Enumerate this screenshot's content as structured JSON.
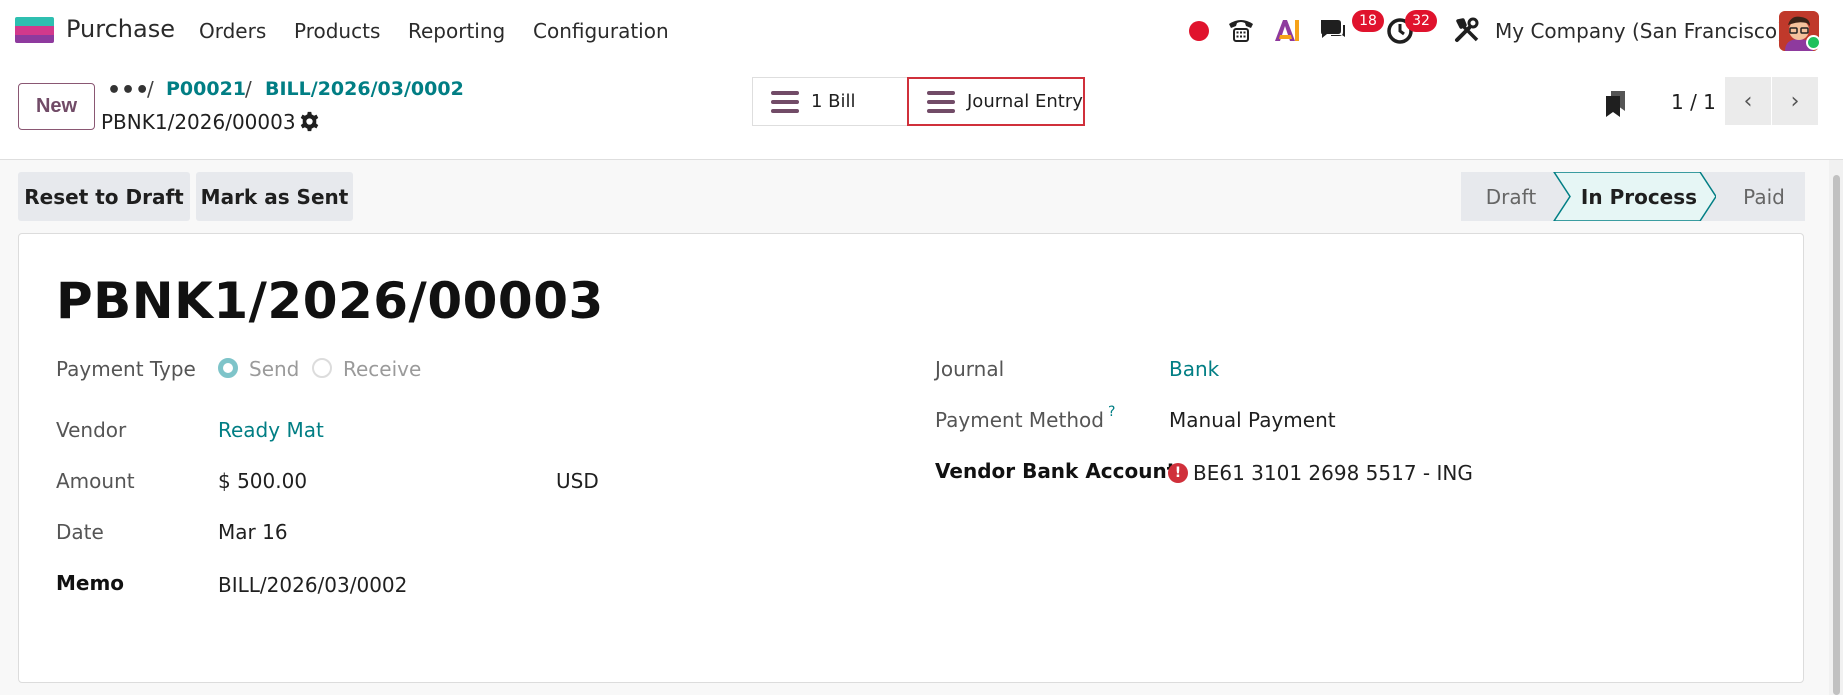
{
  "navbar": {
    "app_name": "Purchase",
    "menu": [
      "Orders",
      "Products",
      "Reporting",
      "Configuration"
    ],
    "chat_badge": "18",
    "activity_badge": "32",
    "company": "My Company (San Francisco)",
    "icons": [
      "record-dot-icon",
      "phone-icon",
      "ai-icon",
      "chat-icon",
      "clock-icon",
      "tools-icon"
    ]
  },
  "control": {
    "new_label": "New",
    "more_label": "•••",
    "breadcrumbs": [
      "P00021",
      "BILL/2026/03/0002"
    ],
    "breadcrumb_sep": "/",
    "record_name": "PBNK1/2026/00003",
    "smart_buttons": [
      "1 Bill",
      "Journal Entry"
    ],
    "pager": "1 / 1",
    "pager_prev": "‹",
    "pager_next": "›"
  },
  "actions": [
    "Reset to Draft",
    "Mark as Sent"
  ],
  "statusbar": {
    "stages": [
      "Draft",
      "In Process",
      "Paid"
    ],
    "current": "In Process"
  },
  "form": {
    "title": "PBNK1/2026/00003",
    "payment_type_label": "Payment Type",
    "payment_type_options": [
      "Send",
      "Receive"
    ],
    "payment_type_selected": "Send",
    "vendor_label": "Vendor",
    "vendor": "Ready Mat",
    "amount_label": "Amount",
    "amount": "$ 500.00",
    "currency": "USD",
    "date_label": "Date",
    "date": "Mar 16",
    "memo_label": "Memo",
    "memo": "BILL/2026/03/0002",
    "journal_label": "Journal",
    "journal": "Bank",
    "payment_method_label": "Payment Method",
    "payment_method_help": "?",
    "payment_method": "Manual Payment",
    "vendor_bank_label": "Vendor Bank Account",
    "vendor_bank_warning": "!",
    "vendor_bank": "BE61 3101 2698 5517 - ING"
  },
  "colors": {
    "accent": "#714b67",
    "link": "#017e84",
    "badge": "#e0132d",
    "highlight_border": "#d0303b",
    "status_active_bg": "#e6f6f5"
  }
}
